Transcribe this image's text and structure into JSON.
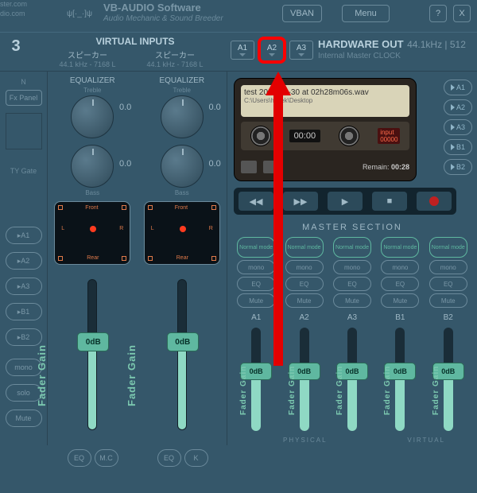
{
  "brand": {
    "line1": "ster.com",
    "line2": "dio.com",
    "name": "VB-AUDIO Software",
    "sub": "Audio Mechanic & Sound Breeder"
  },
  "top": {
    "vban": "VBAN",
    "menu": "Menu",
    "help": "?",
    "close": "X"
  },
  "header": {
    "ch": "3",
    "vi_label": "VIRTUAL INPUTS",
    "vi": [
      {
        "name": "スピーカー",
        "freq": "44.1 kHz - 7168 L"
      },
      {
        "name": "スピーカー",
        "freq": "44.1 kHz - 7168 L"
      }
    ],
    "hw_out": {
      "title": "HARDWARE OUT",
      "freq": "44.1kHz | 512",
      "sub": "Internal Master CLOCK"
    },
    "a": [
      "A1",
      "A2",
      "A3"
    ]
  },
  "left": {
    "n": "N",
    "fx": "Fx Panel",
    "ty": "TY",
    "gate": "Gate",
    "routes": [
      "▸A1",
      "▸A2",
      "▸A3",
      "▸B1",
      "▸B2"
    ],
    "btns": [
      "mono",
      "solo",
      "Mute"
    ]
  },
  "strip": {
    "eq": "EQUALIZER",
    "treble": "Treble",
    "bass": "Bass",
    "val": "0.0",
    "surr": {
      "front": "Front",
      "rear": "Rear",
      "l": "L",
      "r": "R"
    },
    "fader": "0dB",
    "fgain": "Fader Gain",
    "row": [
      "EQ",
      "M.C",
      "K"
    ],
    "mono": "mono",
    "solo": "solo",
    "mute": "Mute"
  },
  "cassette": {
    "file": "test 2021-12-30 at 02h28m06s.wav",
    "path": "C:\\Users\\hasek\\Desktop",
    "time": "00:00",
    "input": "input",
    "inval": "00000",
    "remain_lbl": "Remain:",
    "remain": "00:28"
  },
  "routes_r": [
    "▸A1",
    "▸A2",
    "▸A3",
    "▸B1",
    "▸B2"
  ],
  "master": {
    "label": "MASTER SECTION",
    "mode": "Normal mode",
    "mono": "mono",
    "eq": "EQ",
    "mute": "Mute",
    "ch": [
      "A1",
      "A2",
      "A3",
      "B1",
      "B2"
    ],
    "fader": "0dB",
    "fgain": "Fader Gain",
    "phys": "PHYSICAL",
    "virt": "VIRTUAL"
  }
}
